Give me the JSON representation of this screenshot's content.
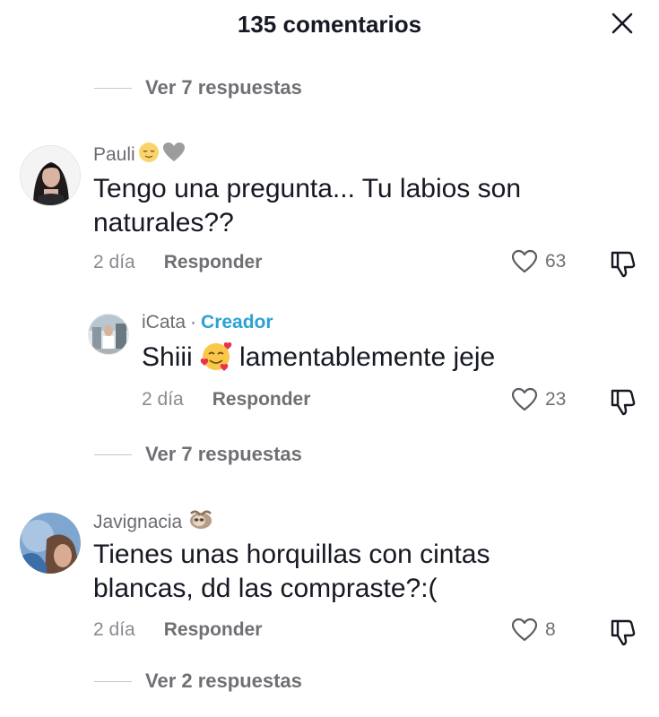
{
  "header": {
    "title": "135 comentarios",
    "close_icon": "close-icon"
  },
  "top_replies": {
    "label": "Ver 7 respuestas"
  },
  "comments": [
    {
      "username": "Pauli",
      "text": "Tengo una pregunta... Tu labios son naturales??",
      "time": "2 día",
      "reply_label": "Responder",
      "likes": "63",
      "replies": [
        {
          "username": "iCata",
          "separator": "·",
          "badge": "Creador",
          "text": "Shiii lamentablemente jeje",
          "time": "2 día",
          "reply_label": "Responder",
          "likes": "23"
        }
      ],
      "more_replies": "Ver 7 respuestas"
    },
    {
      "username": "Javignacia",
      "text": "Tienes unas horquillas con cintas blancas, dd las compraste?:(",
      "time": "2 día",
      "reply_label": "Responder",
      "likes": "8",
      "more_replies": "Ver 2 respuestas"
    }
  ]
}
